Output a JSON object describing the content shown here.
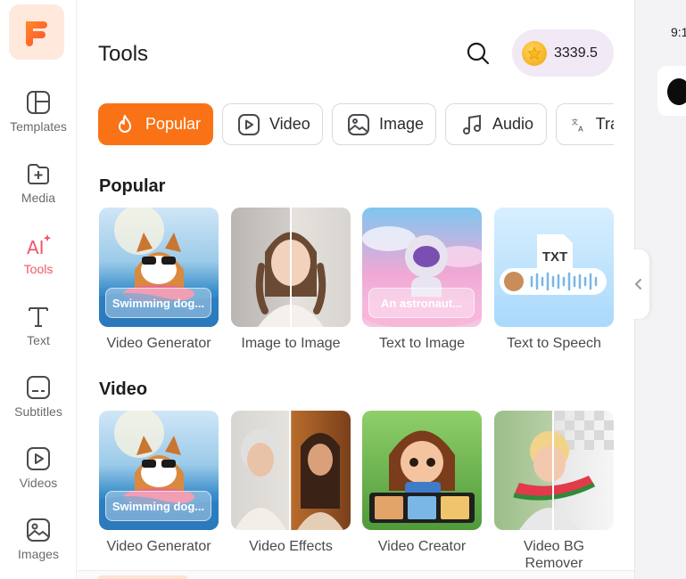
{
  "sidebar": {
    "items": [
      {
        "label": "Templates",
        "icon": "templates-icon"
      },
      {
        "label": "Media",
        "icon": "media-add-icon"
      },
      {
        "label": "Tools",
        "icon": "ai-tools-icon",
        "active": true
      },
      {
        "label": "Text",
        "icon": "text-icon"
      },
      {
        "label": "Subtitles",
        "icon": "subtitles-icon"
      },
      {
        "label": "Videos",
        "icon": "videos-icon"
      },
      {
        "label": "Images",
        "icon": "images-icon"
      }
    ],
    "active_color": "#f0566a"
  },
  "header": {
    "title": "Tools",
    "credits": "3339.5"
  },
  "tabs": [
    {
      "label": "Popular",
      "icon": "flame-icon",
      "active": true
    },
    {
      "label": "Video",
      "icon": "video-play-icon"
    },
    {
      "label": "Image",
      "icon": "image-icon"
    },
    {
      "label": "Audio",
      "icon": "music-icon"
    },
    {
      "label": "Translate",
      "icon": "translate-icon"
    }
  ],
  "sections": {
    "popular": {
      "title": "Popular",
      "cards": [
        {
          "label": "Video Generator",
          "chip": "Swimming dog..."
        },
        {
          "label": "Image to Image"
        },
        {
          "label": "Text to Image",
          "chip": "An astronaut..."
        },
        {
          "label": "Text to Speech",
          "badge": "TXT"
        }
      ]
    },
    "video": {
      "title": "Video",
      "cards": [
        {
          "label": "Video Generator",
          "chip": "Swimming dog..."
        },
        {
          "label": "Video Effects"
        },
        {
          "label": "Video Creator"
        },
        {
          "label": "Video BG Remover"
        }
      ]
    }
  },
  "right_panel": {
    "time": "9:1"
  },
  "colors": {
    "accent": "#f97316",
    "credits_bg": "#f1e9f6"
  }
}
